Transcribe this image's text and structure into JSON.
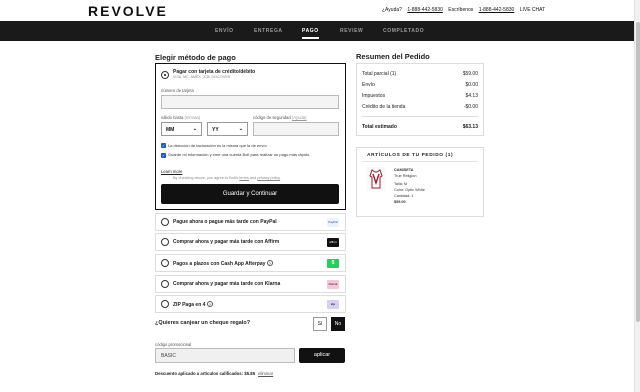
{
  "brand": "REVOLVE",
  "header": {
    "help_label": "¿Ayuda?",
    "phone1": "1-888-442-5830",
    "write_label": "Escríbenos",
    "phone2": "1-888-442-5830",
    "live_chat": "LIVE CHAT"
  },
  "steps": [
    "ENVÍO",
    "ENTREGA",
    "PAGO",
    "REVIEW",
    "COMPLETADO"
  ],
  "active_step": "PAGO",
  "payment": {
    "title": "Elegir método de pago",
    "card_option": {
      "label": "Pagar con tarjeta de crédito/débito",
      "sub": "VISA, MC, AMEX, JCB, DISCOVER",
      "selected": true
    },
    "card_number_label": "número de tarjeta",
    "expiry_label": "válido hasta",
    "expiry_hint": "(mm/aa)",
    "month_value": "MM",
    "year_value": "YY",
    "cvv_label": "código de seguridad",
    "cvv_help": "(Ayuda)",
    "billing_same": "La dirección de facturación es la misma que la de envío",
    "save_info": "Guarde mi información y cree una cuenta Bolt para realizar un pago más rápido.",
    "learn_more": "Learn more",
    "terms_prefix": "By checking above, you agree to Bolt's",
    "terms_link": "terms",
    "terms_and": "and",
    "privacy_link": "privacy policy",
    "submit": "Guardar y Continuar",
    "other_options": [
      {
        "label": "Pague ahora o pague más tarde con PayPal",
        "logo": "PayPal",
        "logo_color": "#eef3fb",
        "logo_text_color": "#1a4fa0"
      },
      {
        "label": "Comprar ahora y pagar más tarde con Affirm",
        "logo": "affirm",
        "logo_color": "#111111",
        "logo_text_color": "#ffffff"
      },
      {
        "label": "Pagos a plazos con Cash App Afterpay",
        "logo": "$",
        "logo_color": "#1fd15a",
        "logo_text_color": "#ffffff",
        "info": "?"
      },
      {
        "label": "Comprar ahora y pagar más tarde con Klarna",
        "logo": "Klarna",
        "logo_color": "#f7c6d8",
        "logo_text_color": "#111111"
      },
      {
        "label": "ZIP Paga en 4",
        "logo": "zip",
        "logo_color": "#d8d0f3",
        "logo_text_color": "#111111",
        "info": "?"
      }
    ]
  },
  "gift": {
    "question": "¿Quieres canjear un cheque regalo?",
    "yes": "Sí",
    "no": "No",
    "selected": "No"
  },
  "promo": {
    "label": "código promocional",
    "value": "BASIC",
    "apply": "aplicar",
    "discount_label": "Descuento aplicado a artículos calificados:",
    "discount_value": "$5.85",
    "remove": "eliminar"
  },
  "summary": {
    "title": "Resumen del Pedido",
    "rows": [
      {
        "label": "Total parcial (1)",
        "value": "$59.00"
      },
      {
        "label": "Envío",
        "value": "$0.00"
      },
      {
        "label": "Impuestos",
        "value": "$4.13"
      },
      {
        "label": "Crédito de la tienda",
        "value": "-$0.00"
      }
    ],
    "total_label": "Total estimado",
    "total_value": "$63.13"
  },
  "items": {
    "title": "ARTÍCULOS DE TU PEDIDO (1)",
    "list": [
      {
        "name": "CAMISETA",
        "brand": "True Religion",
        "size": "Talla: M",
        "color": "Color: Optic White",
        "qty": "Cantidad: 1",
        "price": "$59.00"
      }
    ]
  }
}
